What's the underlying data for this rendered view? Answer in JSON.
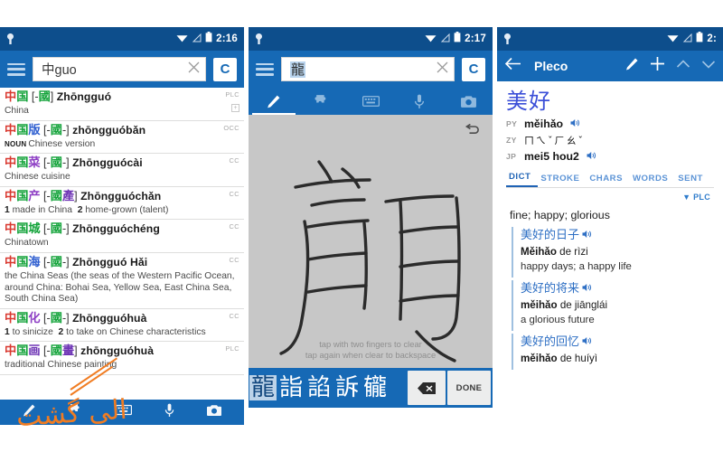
{
  "app": {
    "name": "Pleco"
  },
  "panels": {
    "search": {
      "status": {
        "time": "2:16",
        "icons": [
          "location-pin",
          "wifi",
          "signal",
          "battery"
        ]
      },
      "appbar": {
        "menu_icon": "hamburger-menu-icon",
        "query": "中guo",
        "query_hanzi": "中",
        "query_latin": "guo",
        "clear_icon": "close-icon",
        "mode_button": "C"
      },
      "results": [
        {
          "chars": [
            {
              "t": "中",
              "c": "red"
            },
            {
              "t": "国",
              "c": "green"
            }
          ],
          "bracket_open": "[-",
          "bracket_chars": [
            {
              "t": "國",
              "c": "green"
            }
          ],
          "bracket_close": "]",
          "pinyin": "Zhōngguó",
          "badge": "PLC",
          "definition": "China",
          "pos": "",
          "has_plus": true
        },
        {
          "chars": [
            {
              "t": "中",
              "c": "red"
            },
            {
              "t": "国",
              "c": "green"
            },
            {
              "t": "版",
              "c": "blue"
            }
          ],
          "bracket_open": "[-",
          "bracket_chars": [
            {
              "t": "國",
              "c": "green"
            }
          ],
          "bracket_close": "-]",
          "pinyin": "zhōngguóbǎn",
          "badge": "OCC",
          "definition": "Chinese version",
          "pos": "NOUN",
          "has_plus": false
        },
        {
          "chars": [
            {
              "t": "中",
              "c": "red"
            },
            {
              "t": "国",
              "c": "green"
            },
            {
              "t": "菜",
              "c": "purple"
            }
          ],
          "bracket_open": "[-",
          "bracket_chars": [
            {
              "t": "國",
              "c": "green"
            }
          ],
          "bracket_close": "-]",
          "pinyin": "Zhōngguócài",
          "badge": "CC",
          "definition": "Chinese cuisine",
          "pos": "",
          "has_plus": false
        },
        {
          "chars": [
            {
              "t": "中",
              "c": "red"
            },
            {
              "t": "国",
              "c": "green"
            },
            {
              "t": "产",
              "c": "purple"
            }
          ],
          "bracket_open": "[-",
          "bracket_chars": [
            {
              "t": "國",
              "c": "green"
            },
            {
              "t": "產",
              "c": "violet"
            }
          ],
          "bracket_close": "]",
          "pinyin": "Zhōngguóchǎn",
          "badge": "CC",
          "definition": "1 made in China  2 home-grown (talent)",
          "pos": "",
          "has_plus": false
        },
        {
          "chars": [
            {
              "t": "中",
              "c": "red"
            },
            {
              "t": "国",
              "c": "green"
            },
            {
              "t": "城",
              "c": "green"
            }
          ],
          "bracket_open": "[-",
          "bracket_chars": [
            {
              "t": "國",
              "c": "green"
            }
          ],
          "bracket_close": "-]",
          "pinyin": "Zhōngguóchéng",
          "badge": "CC",
          "definition": "Chinatown",
          "pos": "",
          "has_plus": false
        },
        {
          "chars": [
            {
              "t": "中",
              "c": "red"
            },
            {
              "t": "国",
              "c": "green"
            },
            {
              "t": "海",
              "c": "blue"
            }
          ],
          "bracket_open": "[-",
          "bracket_chars": [
            {
              "t": "國",
              "c": "green"
            }
          ],
          "bracket_close": "-]",
          "pinyin": "Zhōngguó Hǎi",
          "badge": "CC",
          "definition": "the China Seas (the seas of the Western Pacific Ocean, around China: Bohai Sea, Yellow Sea, East China Sea, South China Sea)",
          "pos": "",
          "has_plus": false
        },
        {
          "chars": [
            {
              "t": "中",
              "c": "red"
            },
            {
              "t": "国",
              "c": "green"
            },
            {
              "t": "化",
              "c": "purple"
            }
          ],
          "bracket_open": "[-",
          "bracket_chars": [
            {
              "t": "國",
              "c": "green"
            }
          ],
          "bracket_close": "-]",
          "pinyin": "Zhōngguóhuà",
          "badge": "CC",
          "definition": "1 to sinicize  2 to take on Chinese characteristics",
          "pos": "",
          "has_plus": false
        },
        {
          "chars": [
            {
              "t": "中",
              "c": "red"
            },
            {
              "t": "国",
              "c": "green"
            },
            {
              "t": "画",
              "c": "violet"
            }
          ],
          "bracket_open": "[-",
          "bracket_chars": [
            {
              "t": "國",
              "c": "green"
            },
            {
              "t": "畫",
              "c": "violet"
            }
          ],
          "bracket_close": "]",
          "pinyin": "zhōngguóhuà",
          "badge": "PLC",
          "definition": "traditional Chinese painting",
          "pos": "",
          "has_plus": false
        }
      ],
      "bottom_icons": [
        "pencil-icon",
        "puzzle-icon",
        "keyboard-icon",
        "microphone-icon",
        "camera-icon"
      ]
    },
    "handwriting": {
      "status": {
        "time": "2:17"
      },
      "appbar": {
        "menu_icon": "hamburger-menu-icon",
        "query": "龍",
        "clear_icon": "close-icon",
        "mode_button": "C"
      },
      "input_tabs": [
        "pencil-icon",
        "puzzle-icon",
        "keyboard-icon",
        "microphone-icon",
        "camera-icon"
      ],
      "active_tab_index": 0,
      "canvas": {
        "drawn_character": "龍",
        "undo_icon": "undo-arrow-icon",
        "hint_line1": "tap with two fingers to clear",
        "hint_line2": "tap again when clear to backspace"
      },
      "candidates": [
        "龍",
        "詣",
        "諂",
        "訴",
        "龓"
      ],
      "selected_candidate_index": 0,
      "backspace_icon": "backspace-icon",
      "done_label": "DONE"
    },
    "entry": {
      "status": {
        "time": "2:"
      },
      "appbar": {
        "back_icon": "back-arrow-icon",
        "title": "Pleco",
        "icons": [
          "pencil-icon",
          "plus-icon",
          "chevron-up-icon",
          "chevron-down-icon"
        ]
      },
      "headword": "美好",
      "pronunciations": [
        {
          "label": "PY",
          "value": "měihǎo",
          "audio": true
        },
        {
          "label": "ZY",
          "value": "ㄇㄟˇㄏㄠˇ",
          "audio": false
        },
        {
          "label": "JP",
          "value": "mei5 hou2",
          "audio": true
        }
      ],
      "tabs": [
        "DICT",
        "STROKE",
        "CHARS",
        "WORDS",
        "SENT"
      ],
      "active_tab": "DICT",
      "source_label": "PLC",
      "gloss": "fine; happy; glorious",
      "examples": [
        {
          "hanzi": "美好的日子",
          "pinyin_bold": "Měihǎo",
          "pinyin_rest": " de rìzi",
          "english": "happy days; a happy life"
        },
        {
          "hanzi": "美好的将来",
          "pinyin_bold": "měihǎo",
          "pinyin_rest": " de jiānglái",
          "english": "a glorious future"
        },
        {
          "hanzi": "美好的回忆",
          "pinyin_bold": "měihǎo",
          "pinyin_rest": " de huíyì",
          "english": ""
        }
      ]
    }
  },
  "watermark": {
    "text": "الی گشت",
    "color": "#f07c22"
  },
  "colors": {
    "appbar_blue": "#1669b5",
    "statusbar_blue": "#0d4e8c",
    "hanzi_red": "#d9382f",
    "hanzi_green": "#13a33a",
    "hanzi_blue": "#2f5fd0",
    "headword_blue": "#3b4fd8",
    "canvas_gray": "#c7c7c7"
  }
}
